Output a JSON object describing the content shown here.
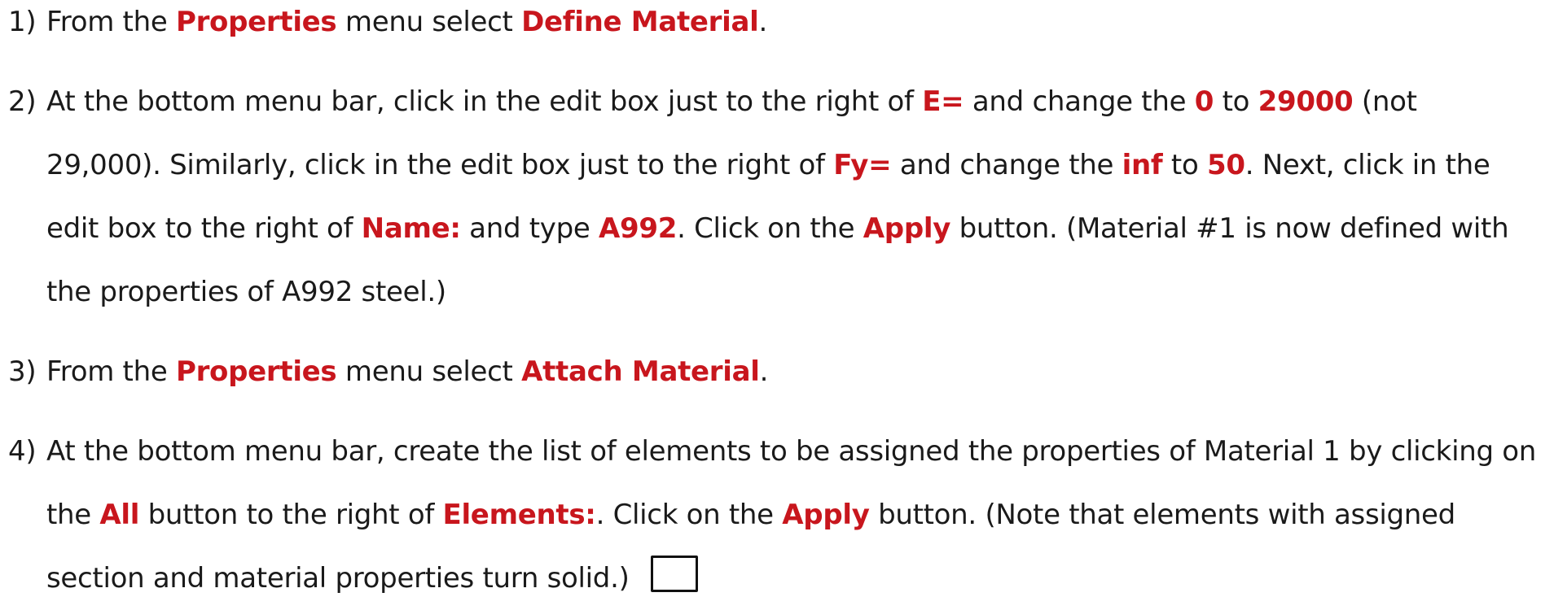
{
  "steps": [
    {
      "number": "1)",
      "parts": [
        {
          "t": "From the "
        },
        {
          "k": "Properties"
        },
        {
          "t": " menu select "
        },
        {
          "k": "Define Material"
        },
        {
          "t": "."
        }
      ]
    },
    {
      "number": "2)",
      "parts": [
        {
          "t": "At the bottom menu bar, click in the edit box just to the right of "
        },
        {
          "k": "E="
        },
        {
          "t": " and change the "
        },
        {
          "k": "0"
        },
        {
          "t": " to "
        },
        {
          "k": "29000"
        },
        {
          "t": " (not 29,000). Similarly, click in the edit box just to the right of "
        },
        {
          "k": "Fy="
        },
        {
          "t": " and change the "
        },
        {
          "k": "inf"
        },
        {
          "t": " to "
        },
        {
          "k": "50"
        },
        {
          "t": ". Next, click in the edit box to the right of "
        },
        {
          "k": "Name:"
        },
        {
          "t": " and type "
        },
        {
          "k": "A992"
        },
        {
          "t": ". Click on the "
        },
        {
          "k": "Apply"
        },
        {
          "t": " button. (Material #1 is now defined with the properties of A992 steel.)"
        }
      ]
    },
    {
      "number": "3)",
      "parts": [
        {
          "t": "From the "
        },
        {
          "k": "Properties"
        },
        {
          "t": " menu select "
        },
        {
          "k": "Attach Material"
        },
        {
          "t": "."
        }
      ]
    },
    {
      "number": "4)",
      "parts": [
        {
          "t": "At the bottom menu bar, create the list of elements to be assigned the properties of Material 1 by clicking on the "
        },
        {
          "k": "All"
        },
        {
          "t": " button to the right of "
        },
        {
          "k": "Elements:"
        },
        {
          "t": ". Click on the "
        },
        {
          "k": "Apply"
        },
        {
          "t": " button. (Note that elements with assigned section and material properties turn solid.)"
        }
      ]
    }
  ],
  "colors": {
    "keyword": "#c8161d",
    "text": "#1a1a1a"
  }
}
